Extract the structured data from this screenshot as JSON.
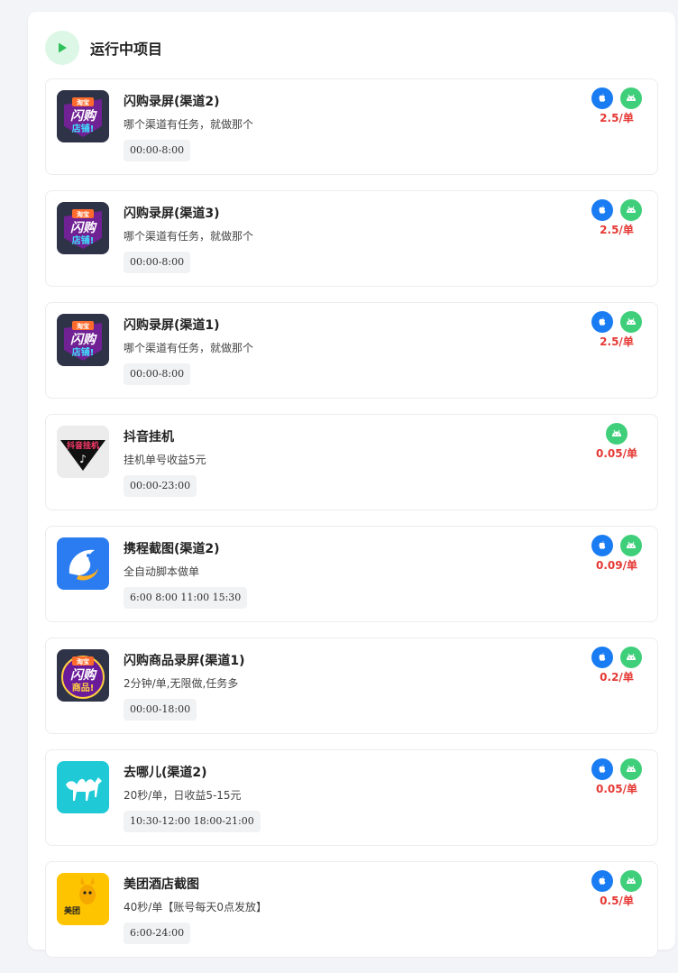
{
  "panel": {
    "title": "运行中项目",
    "icon": "play-icon",
    "accent": "#2fbf5b"
  },
  "colors": {
    "price": "#e53935",
    "ios_badge": "#1a7cf2",
    "android_badge": "#3fcf7a"
  },
  "projects": [
    {
      "name": "闪购录屏(渠道2)",
      "desc": "哪个渠道有任务，就做那个",
      "time": "00:00-8:00",
      "price": "2.5/单",
      "platforms": [
        "ios",
        "android"
      ],
      "icon": "shangou-icon",
      "icon_text": [
        "淘宝",
        "闪购",
        "店铺!"
      ]
    },
    {
      "name": "闪购录屏(渠道3)",
      "desc": "哪个渠道有任务，就做那个",
      "time": "00:00-8:00",
      "price": "2.5/单",
      "platforms": [
        "ios",
        "android"
      ],
      "icon": "shangou-icon",
      "icon_text": [
        "淘宝",
        "闪购",
        "店铺!"
      ]
    },
    {
      "name": "闪购录屏(渠道1)",
      "desc": "哪个渠道有任务，就做那个",
      "time": "00:00-8:00",
      "price": "2.5/单",
      "platforms": [
        "ios",
        "android"
      ],
      "icon": "shangou-icon",
      "icon_text": [
        "淘宝",
        "闪购",
        "店铺!"
      ]
    },
    {
      "name": "抖音挂机",
      "desc": "挂机单号收益5元",
      "time": "00:00-23:00",
      "price": "0.05/单",
      "platforms": [
        "android"
      ],
      "icon": "douyin-icon",
      "icon_text": [
        "抖音挂机"
      ]
    },
    {
      "name": "携程截图(渠道2)",
      "desc": "全自动脚本做单",
      "time": "6:00 8:00 11:00 15:30",
      "price": "0.09/单",
      "platforms": [
        "ios",
        "android"
      ],
      "icon": "ctrip-icon",
      "icon_text": []
    },
    {
      "name": "闪购商品录屏(渠道1)",
      "desc": "2分钟/单,无限做,任务多",
      "time": "00:00-18:00",
      "price": "0.2/单",
      "platforms": [
        "ios",
        "android"
      ],
      "icon": "shangou-goods-icon",
      "icon_text": [
        "淘宝",
        "闪购",
        "商品!"
      ]
    },
    {
      "name": "去哪儿(渠道2)",
      "desc": "20秒/单，日收益5-15元",
      "time": "10:30-12:00 18:00-21:00",
      "price": "0.05/单",
      "platforms": [
        "ios",
        "android"
      ],
      "icon": "qunar-icon",
      "icon_text": []
    },
    {
      "name": "美团酒店截图",
      "desc": "40秒/单【账号每天0点发放】",
      "time": "6:00-24:00",
      "price": "0.5/单",
      "platforms": [
        "ios",
        "android"
      ],
      "icon": "meituan-icon",
      "icon_text": [
        "美团"
      ]
    }
  ]
}
